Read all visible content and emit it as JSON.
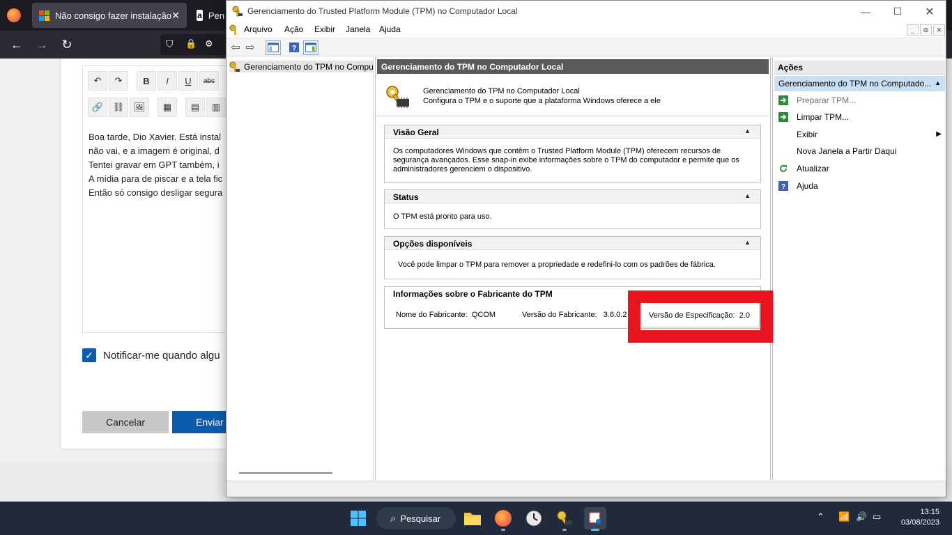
{
  "browser": {
    "tabs": [
      {
        "label": "Não consigo fazer instalação lir"
      },
      {
        "label": "Pen"
      }
    ],
    "editor": {
      "lines": [
        "Boa tarde, Dio Xavier. Está instal",
        "não vai, e a imagem é original, d",
        "Tentei gravar em GPT também, i",
        "A mídia para de piscar e a tela fic",
        "Então só consigo desligar segura"
      ],
      "toolbar_row1": [
        "↶",
        "↷",
        "B",
        "I",
        "U",
        "abc"
      ],
      "toolbar_row2": [
        "🔗",
        "⛓",
        "🖼",
        "▦",
        "▤",
        "▥"
      ]
    },
    "notify_label": "Notificar-me quando algu",
    "cancel_label": "Cancelar",
    "send_label": "Enviar"
  },
  "mmc": {
    "title": "Gerenciamento do Trusted Platform Module (TPM) no Computador Local",
    "menu": [
      "Arquivo",
      "Ação",
      "Exibir",
      "Janela",
      "Ajuda"
    ],
    "tree_item": "Gerenciamento do TPM no Computador Local",
    "center_header": "Gerenciamento do TPM no Computador Local",
    "intro": {
      "line1": "Gerenciamento do TPM no Computador Local",
      "line2": "Configura o TPM e o suporte que a plataforma Windows oferece a ele"
    },
    "sections": {
      "overview": {
        "title": "Visão Geral",
        "text": "Os computadores Windows que contêm o Trusted Platform Module (TPM) oferecem recursos de segurança avançados. Esse snap-in exibe informações sobre o TPM do computador e permite que os administradores gerenciem o dispositivo."
      },
      "status": {
        "title": "Status",
        "text": "O TPM está pronto para uso."
      },
      "options": {
        "title": "Opções disponíveis",
        "text": "Você pode limpar o TPM para remover a propriedade e redefini-lo com os padrões de fábrica."
      },
      "manufacturer": {
        "title": "Informações sobre o Fabricante do TPM",
        "name_label": "Nome do Fabricante:",
        "name_value": "QCOM",
        "version_label": "Versão do Fabricante:",
        "version_value": "3.6.0.2",
        "spec_label": "Versão de Especificação:",
        "spec_value": "2.0"
      }
    },
    "actions": {
      "header": "Ações",
      "group": "Gerenciamento do TPM no Computado...",
      "items": [
        {
          "label": "Preparar TPM...",
          "icon": "green-arrow-icon",
          "disabled": true
        },
        {
          "label": "Limpar TPM...",
          "icon": "green-arrow-icon",
          "disabled": false
        },
        {
          "label": "Exibir",
          "icon": "",
          "disabled": false
        },
        {
          "label": "Nova Janela a Partir Daqui",
          "icon": "",
          "disabled": false
        },
        {
          "label": "Atualizar",
          "icon": "refresh-icon",
          "disabled": false
        },
        {
          "label": "Ajuda",
          "icon": "help-icon",
          "disabled": false
        }
      ]
    }
  },
  "taskbar": {
    "search_label": "Pesquisar",
    "time": "13:15",
    "date": "03/08/2023"
  },
  "colors": {
    "highlight_red": "#e8141e",
    "taskbar_bg": "#202a3c",
    "actions_group_bg": "#c9dff4",
    "center_header_bg": "#5a5a5a"
  }
}
